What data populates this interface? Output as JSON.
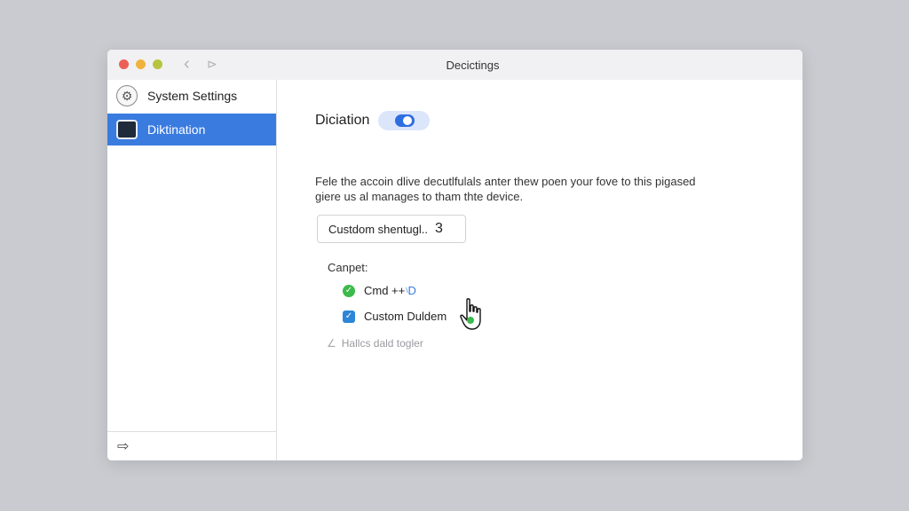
{
  "window": {
    "title": "Decictings",
    "nav_back": "‹",
    "nav_forward": "⊳"
  },
  "sidebar": {
    "items": [
      {
        "label": "System Settings",
        "icon": "gear-icon"
      },
      {
        "label": "Diktination",
        "icon": "dictation-icon",
        "selected": true
      }
    ],
    "footer_icon": "forward-icon"
  },
  "main": {
    "title": "Diciation",
    "toggle_on": true,
    "description": "Fele the accoin dlive decutlfulals anter thew poen your fove to this pigased giere us al manages to tham thte device.",
    "shortcut": {
      "label": "Custdom shentugl..",
      "value": "3"
    },
    "section_label": "Canpet:",
    "options": [
      {
        "label": "Cmd ++",
        "sup": "\\",
        "suffix": "D",
        "checked": true,
        "color": "#3cba4b"
      },
      {
        "label": "Custom Duldem",
        "checked": true,
        "color": "#2e86d8"
      }
    ],
    "hint": "Hallcs dald togler"
  },
  "colors": {
    "accent": "#3a7be0",
    "background": "#c9cbd0"
  }
}
